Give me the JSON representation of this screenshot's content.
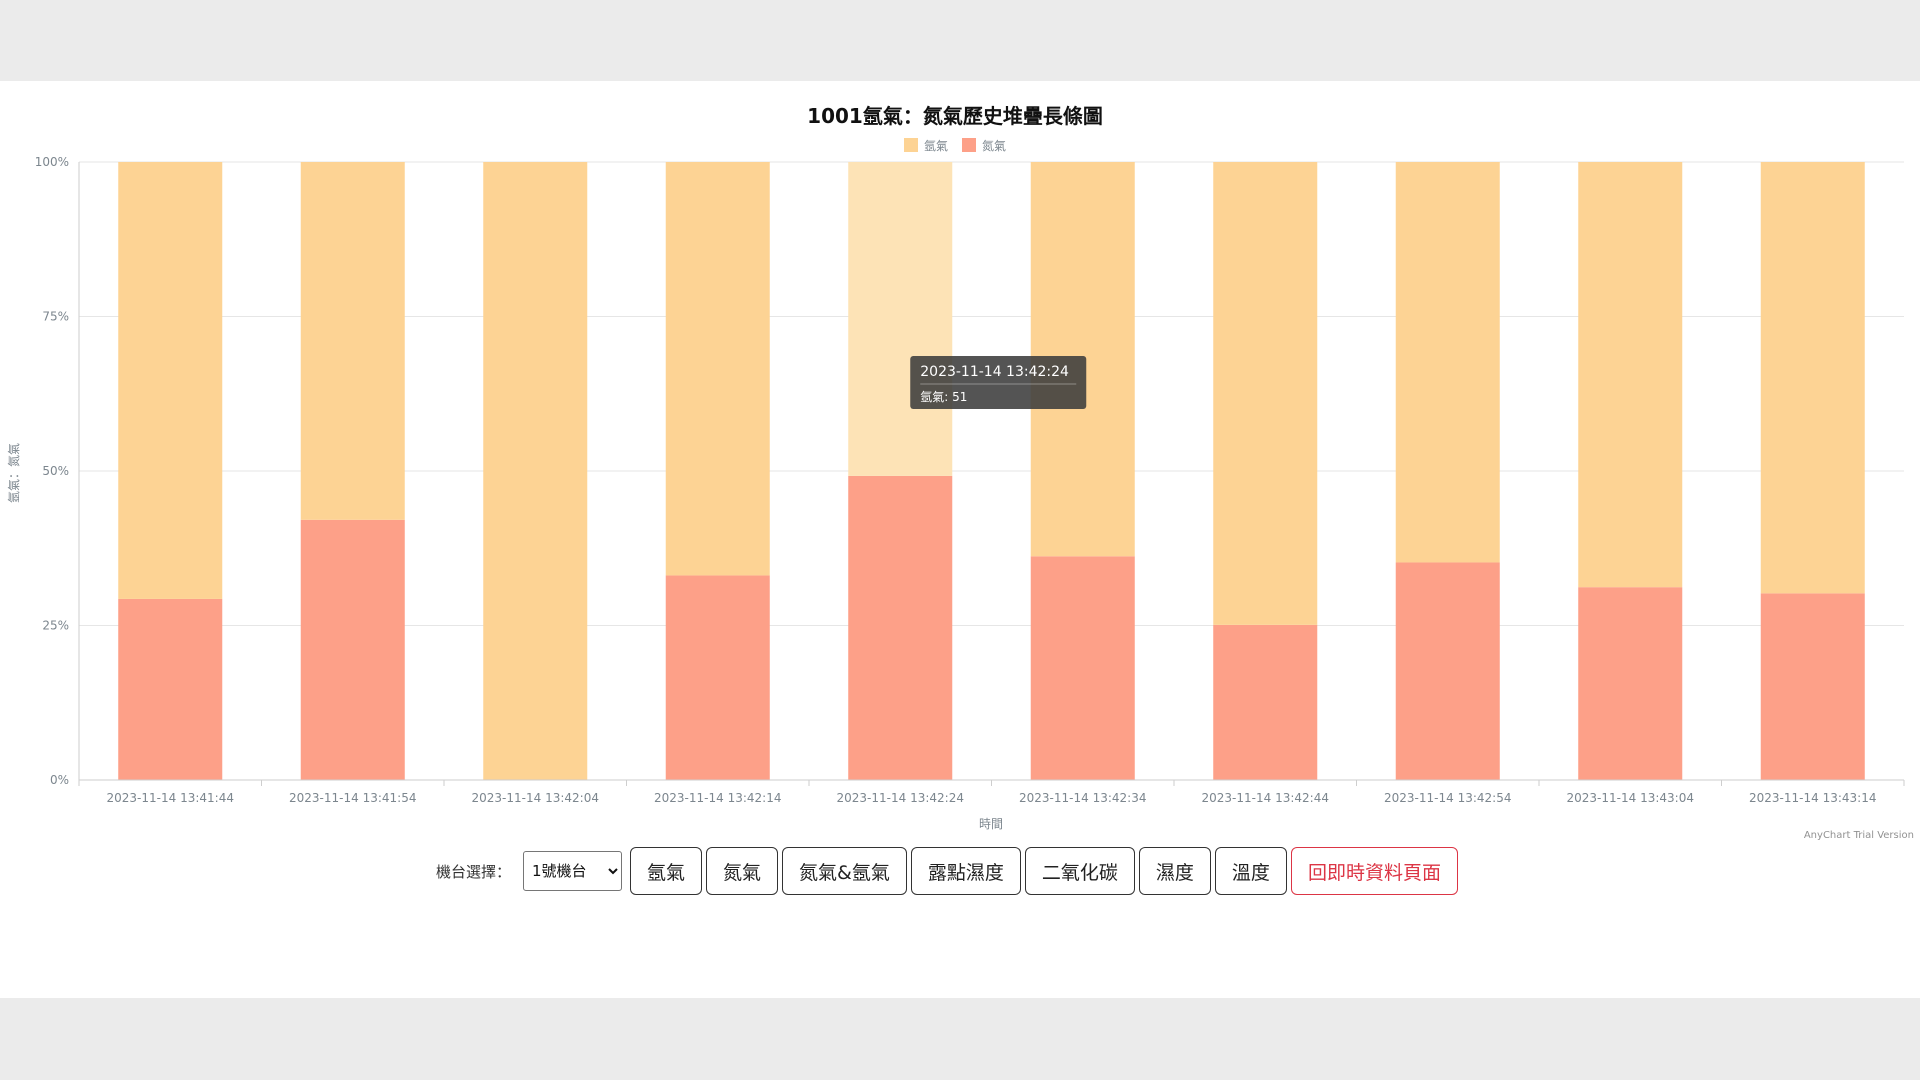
{
  "colors": {
    "argon": "#fdd394",
    "argon_hover": "#fde3b6",
    "nitrogen": "#fda088",
    "danger": "#dc3545"
  },
  "chart_data": {
    "type": "bar",
    "stacking": "percent",
    "title": "1001氬氣：氮氣歷史堆疊長條圖",
    "xlabel": "時間",
    "ylabel": "氬氣：氮氣",
    "ylim": [
      0,
      100
    ],
    "y_ticks": [
      "0%",
      "25%",
      "50%",
      "75%",
      "100%"
    ],
    "grid": true,
    "legend_position": "top-center",
    "categories": [
      "2023-11-14 13:41:44",
      "2023-11-14 13:41:54",
      "2023-11-14 13:42:04",
      "2023-11-14 13:42:14",
      "2023-11-14 13:42:24",
      "2023-11-14 13:42:34",
      "2023-11-14 13:42:44",
      "2023-11-14 13:42:54",
      "2023-11-14 13:43:04",
      "2023-11-14 13:43:14"
    ],
    "series": [
      {
        "name": "氮氣",
        "values": [
          29.3,
          42.1,
          0,
          33.1,
          49.2,
          36.2,
          25.1,
          35.2,
          31.2,
          30.2
        ]
      },
      {
        "name": "氬氣",
        "values": [
          70.7,
          57.9,
          100,
          66.9,
          50.8,
          63.8,
          74.9,
          64.8,
          68.8,
          69.8
        ]
      }
    ],
    "hovered_index": 4,
    "tooltip": {
      "title": "2023-11-14 13:42:24",
      "line": "氬氣: 51"
    },
    "credits": "AnyChart Trial Version"
  },
  "controls": {
    "machine_label": "機台選擇：",
    "machine_selected": "1號機台",
    "buttons": [
      "氬氣",
      "氮氣",
      "氮氣&氬氣",
      "露點濕度",
      "二氧化碳",
      "濕度",
      "溫度"
    ],
    "back_button": "回即時資料頁面"
  }
}
